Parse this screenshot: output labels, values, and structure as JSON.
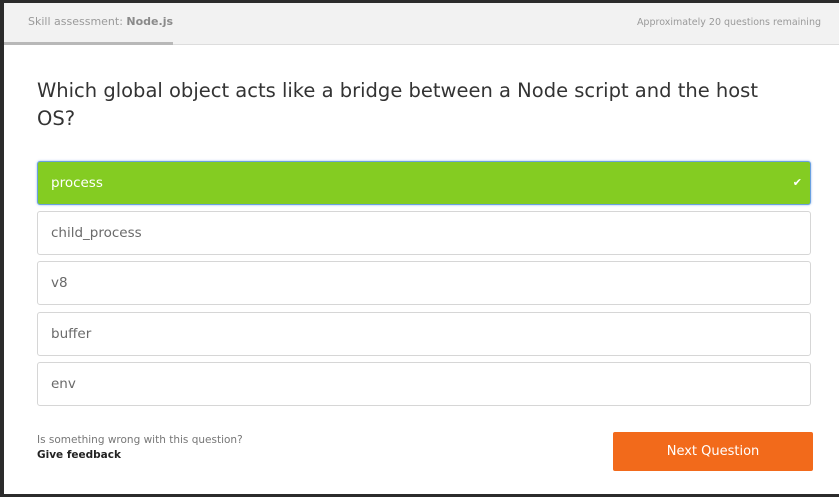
{
  "header": {
    "skill_prefix": "Skill assessment: ",
    "skill_name": "Node.js",
    "remaining": "Approximately 20 questions remaining"
  },
  "question": {
    "text": "Which global object acts like a bridge between a Node script and the host OS?"
  },
  "options": [
    {
      "label": "process",
      "selected": true
    },
    {
      "label": "child_process",
      "selected": false
    },
    {
      "label": "v8",
      "selected": false
    },
    {
      "label": "buffer",
      "selected": false
    },
    {
      "label": "env",
      "selected": false
    }
  ],
  "footer": {
    "feedback_question": "Is something wrong with this question?",
    "feedback_link": "Give feedback",
    "next_label": "Next Question"
  },
  "colors": {
    "selected_option": "#84cc22",
    "next_button": "#f26a1b"
  },
  "icons": {
    "selected_check": "check-icon"
  }
}
